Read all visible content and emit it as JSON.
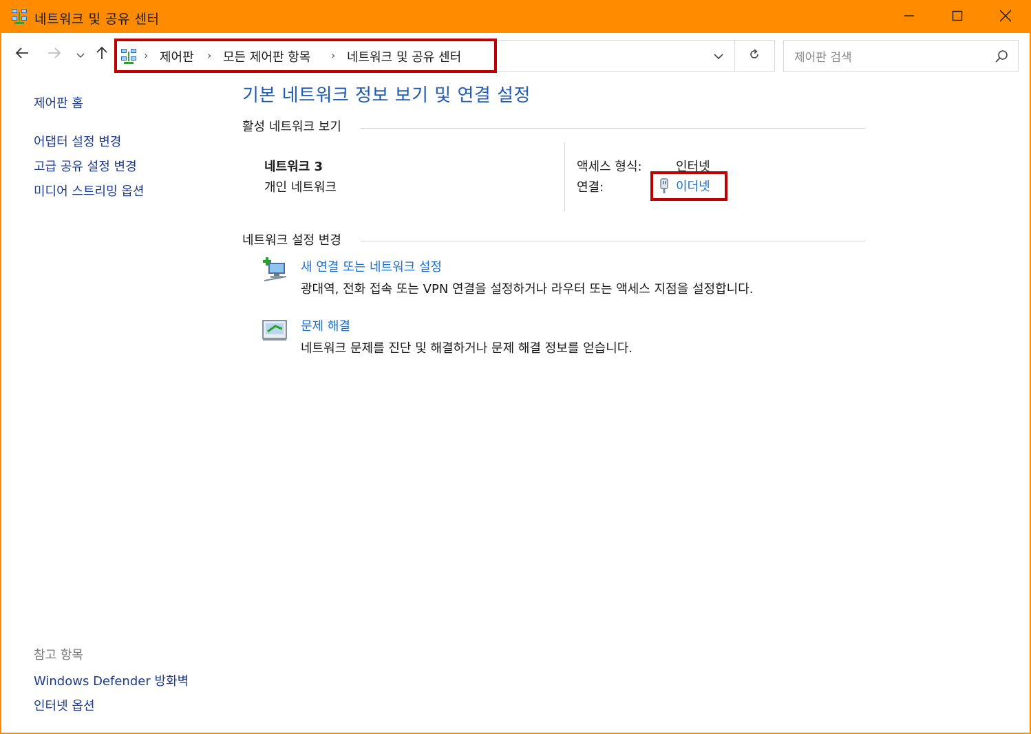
{
  "window": {
    "title": "네트워크 및 공유 센터",
    "accent_color": "#ff8c00",
    "icons": {
      "app": "network-sharing-icon",
      "minimize": "minimize-icon",
      "maximize": "maximize-icon",
      "close": "close-icon"
    }
  },
  "nav": {
    "breadcrumb": [
      "제어판",
      "모든 제어판 항목",
      "네트워크 및 공유 센터"
    ],
    "search_placeholder": "제어판 검색",
    "icons": {
      "back": "back-arrow-icon",
      "forward": "forward-arrow-icon",
      "recent": "chevron-down-icon",
      "up": "up-arrow-icon",
      "dropdown": "chevron-down-icon",
      "refresh": "refresh-icon",
      "search": "search-icon"
    },
    "highlight_color": "#c00000"
  },
  "sidebar": {
    "home": "제어판 홈",
    "links": [
      "어댑터 설정 변경",
      "고급 공유 설정 변경",
      "미디어 스트리밍 옵션"
    ],
    "see_also_label": "참고 항목",
    "see_also_links": [
      "Windows Defender 방화벽",
      "인터넷 옵션"
    ]
  },
  "main": {
    "title": "기본 네트워크 정보 보기 및 연결 설정",
    "active_section": "활성 네트워크 보기",
    "network": {
      "name": "네트워크 3",
      "type": "개인 네트워크",
      "access_label": "액세스 형식:",
      "access_value": "인터넷",
      "connection_label": "연결:",
      "connection_value": "이더넷",
      "connection_icon": "ethernet-icon"
    },
    "change_section": "네트워크 설정 변경",
    "tasks": [
      {
        "title": "새 연결 또는 네트워크 설정",
        "description": "광대역, 전화 접속 또는 VPN 연결을 설정하거나 라우터 또는 액세스 지점을 설정합니다.",
        "icon": "new-connection-icon"
      },
      {
        "title": "문제 해결",
        "description": "네트워크 문제를 진단 및 해결하거나 문제 해결 정보를 얻습니다.",
        "icon": "troubleshoot-icon"
      }
    ],
    "link_color": "#1a6fd1"
  }
}
